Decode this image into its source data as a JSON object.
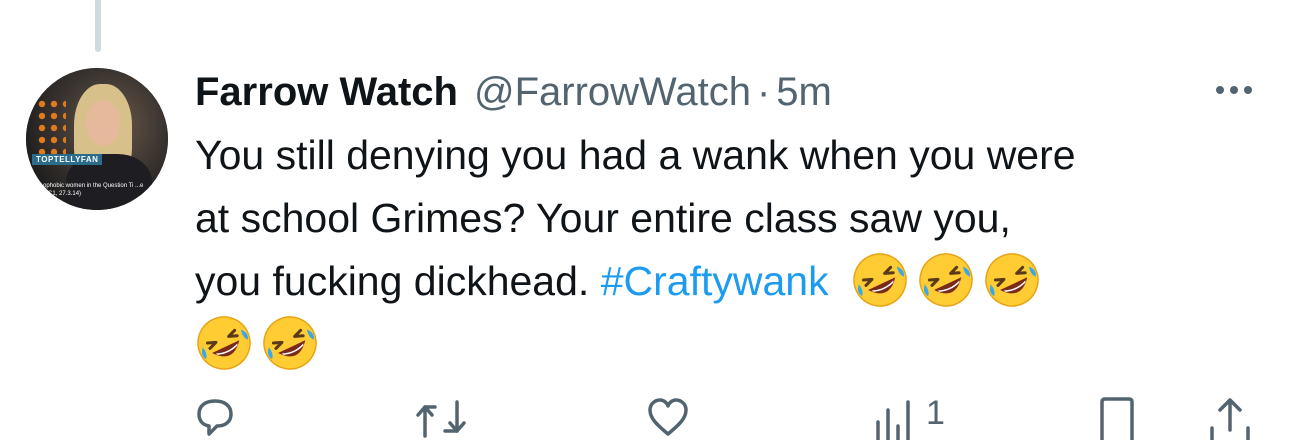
{
  "tweet": {
    "name": "Farrow Watch",
    "handle": "@FarrowWatch",
    "separator": "·",
    "time": "5m",
    "lines": [
      "You still denying you had a wank when you were",
      "at school Grimes?  Your entire class saw you,",
      "you fucking dickhead.  "
    ],
    "hashtag": "#Craftywank",
    "emoji_name": "rolling-on-the-floor-laughing-icon"
  },
  "avatar": {
    "tag": "TOPTELLYFAN",
    "caption": "...ophobic women in the Question Ti ...e (BBC1, 27.3.14)"
  },
  "actions": {
    "views_count": "1"
  },
  "colors": {
    "text": "#0f1419",
    "secondary": "#536471",
    "link": "#1d9bf0",
    "thread_line": "#cfd9de"
  }
}
